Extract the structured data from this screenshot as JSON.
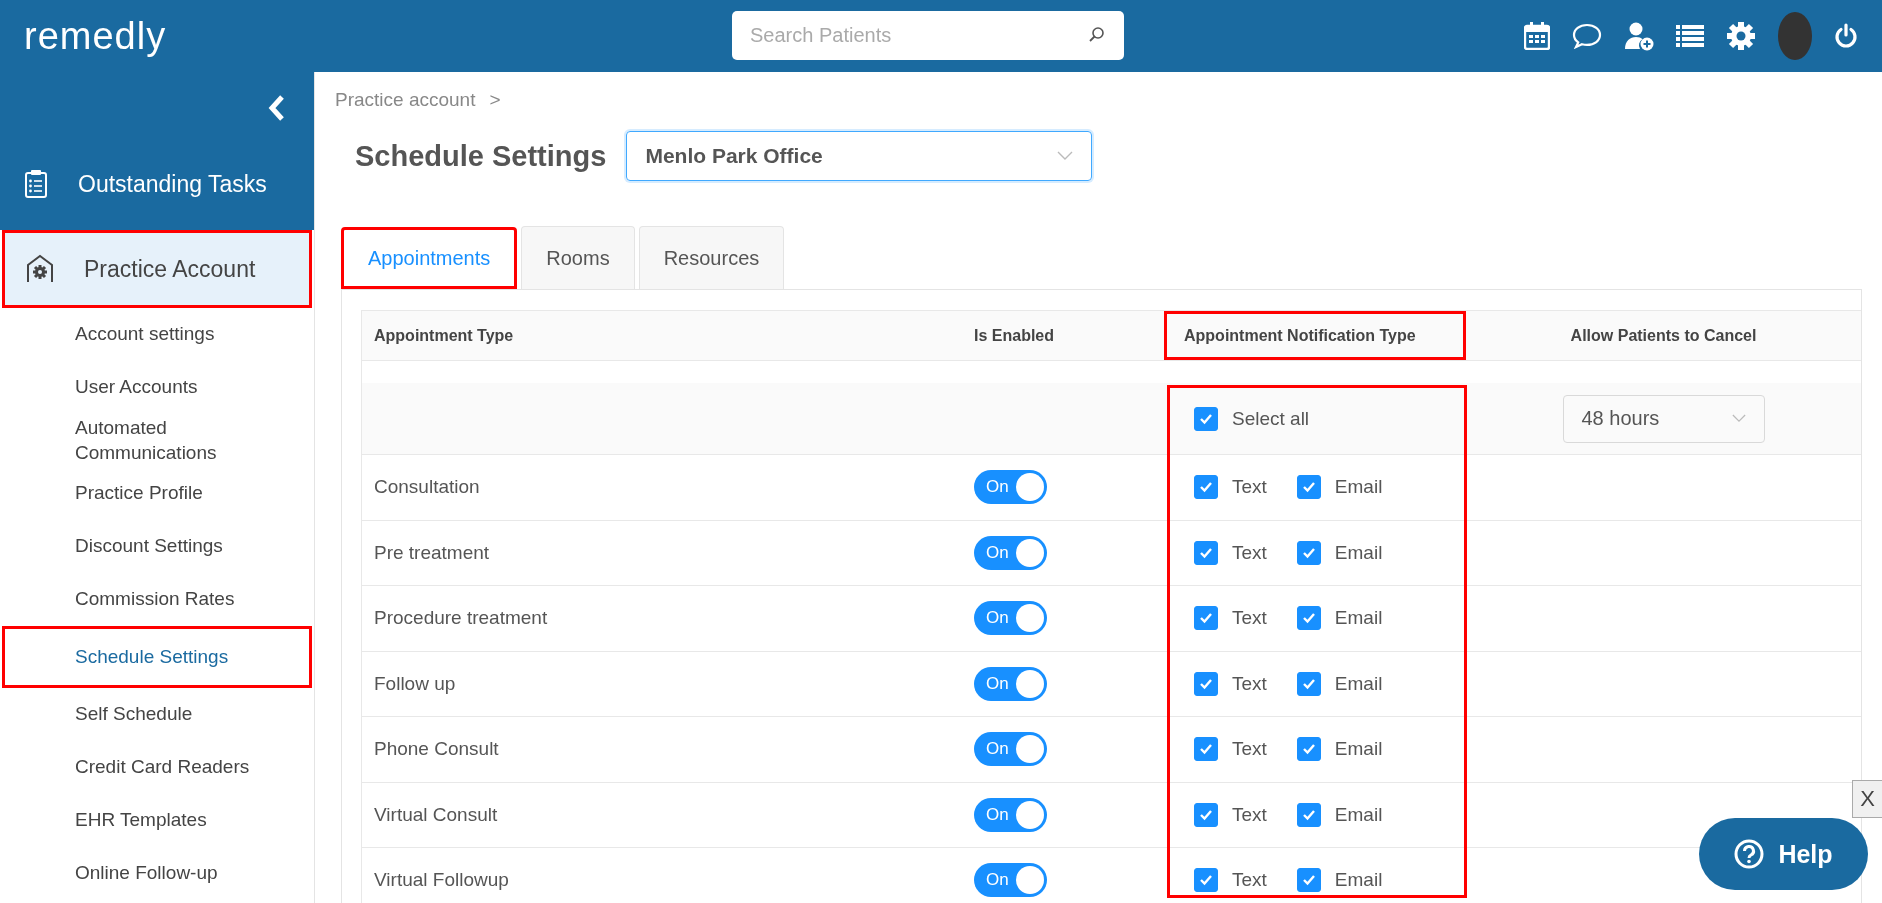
{
  "topbar": {
    "logo": "remedly",
    "search": {
      "placeholder": "Search Patients"
    }
  },
  "sidebar": {
    "items": [
      {
        "label": "Outstanding Tasks",
        "kind": "tasks",
        "selected": false,
        "highlighted": false
      },
      {
        "label": "Practice Account",
        "kind": "practice",
        "selected": true,
        "highlighted": true,
        "children": [
          {
            "label": "Account settings",
            "selected": false,
            "highlighted": false
          },
          {
            "label": "User Accounts",
            "selected": false,
            "highlighted": false
          },
          {
            "label": "Automated Communications",
            "selected": false,
            "highlighted": false
          },
          {
            "label": "Practice Profile",
            "selected": false,
            "highlighted": false
          },
          {
            "label": "Discount Settings",
            "selected": false,
            "highlighted": false
          },
          {
            "label": "Commission Rates",
            "selected": false,
            "highlighted": false
          },
          {
            "label": "Schedule Settings",
            "selected": true,
            "highlighted": true
          },
          {
            "label": "Self Schedule",
            "selected": false,
            "highlighted": false
          },
          {
            "label": "Credit Card Readers",
            "selected": false,
            "highlighted": false
          },
          {
            "label": "EHR Templates",
            "selected": false,
            "highlighted": false
          },
          {
            "label": "Online Follow-up",
            "selected": false,
            "highlighted": false
          }
        ]
      }
    ]
  },
  "breadcrumb": {
    "items": [
      "Practice account"
    ],
    "separator": ">"
  },
  "title": "Schedule Settings",
  "location_select": {
    "value": "Menlo Park Office"
  },
  "tabs": [
    {
      "label": "Appointments",
      "selected": true,
      "highlighted": true
    },
    {
      "label": "Rooms",
      "selected": false,
      "highlighted": false
    },
    {
      "label": "Resources",
      "selected": false,
      "highlighted": false
    }
  ],
  "table": {
    "columns": [
      {
        "label": "Appointment Type",
        "highlighted": false
      },
      {
        "label": "Is Enabled",
        "highlighted": false
      },
      {
        "label": "Appointment Notification Type",
        "highlighted": true
      },
      {
        "label": "Allow Patients to Cancel",
        "highlighted": false
      }
    ],
    "notification_cells_highlighted": true,
    "select_all": {
      "label": "Select all",
      "checked": true
    },
    "cancel_window": {
      "value": "48 hours"
    },
    "rows": [
      {
        "name": "Consultation",
        "enabled": true,
        "toggle_label": "On",
        "text": {
          "label": "Text",
          "checked": true
        },
        "email": {
          "label": "Email",
          "checked": true
        }
      },
      {
        "name": "Pre treatment",
        "enabled": true,
        "toggle_label": "On",
        "text": {
          "label": "Text",
          "checked": true
        },
        "email": {
          "label": "Email",
          "checked": true
        }
      },
      {
        "name": "Procedure treatment",
        "enabled": true,
        "toggle_label": "On",
        "text": {
          "label": "Text",
          "checked": true
        },
        "email": {
          "label": "Email",
          "checked": true
        }
      },
      {
        "name": "Follow up",
        "enabled": true,
        "toggle_label": "On",
        "text": {
          "label": "Text",
          "checked": true
        },
        "email": {
          "label": "Email",
          "checked": true
        }
      },
      {
        "name": "Phone Consult",
        "enabled": true,
        "toggle_label": "On",
        "text": {
          "label": "Text",
          "checked": true
        },
        "email": {
          "label": "Email",
          "checked": true
        }
      },
      {
        "name": "Virtual Consult",
        "enabled": true,
        "toggle_label": "On",
        "text": {
          "label": "Text",
          "checked": true
        },
        "email": {
          "label": "Email",
          "checked": true
        }
      },
      {
        "name": "Virtual Followup",
        "enabled": true,
        "toggle_label": "On",
        "text": {
          "label": "Text",
          "checked": true
        },
        "email": {
          "label": "Email",
          "checked": true
        }
      }
    ]
  },
  "close_button": {
    "label": "X"
  },
  "help_button": {
    "label": "Help"
  }
}
